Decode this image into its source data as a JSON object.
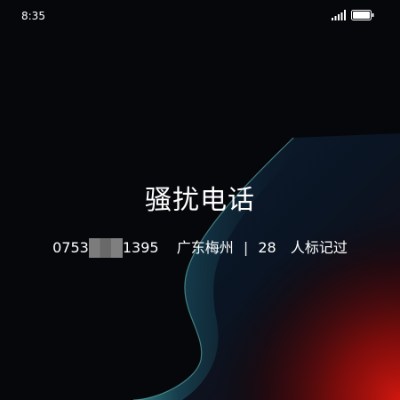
{
  "status_bar": {
    "time": "8:35",
    "signal_icon": "signal-icon",
    "battery_icon": "battery-icon"
  },
  "call": {
    "label": "骚扰电话",
    "number_prefix": "0753",
    "number_suffix": "1395",
    "location": "广东梅州",
    "separator": "|",
    "mark_count": "28",
    "mark_text": "人标记过"
  },
  "colors": {
    "background": "#05070b",
    "wave_teal": "#3aa3a6",
    "glow_red": "#c0140f"
  }
}
